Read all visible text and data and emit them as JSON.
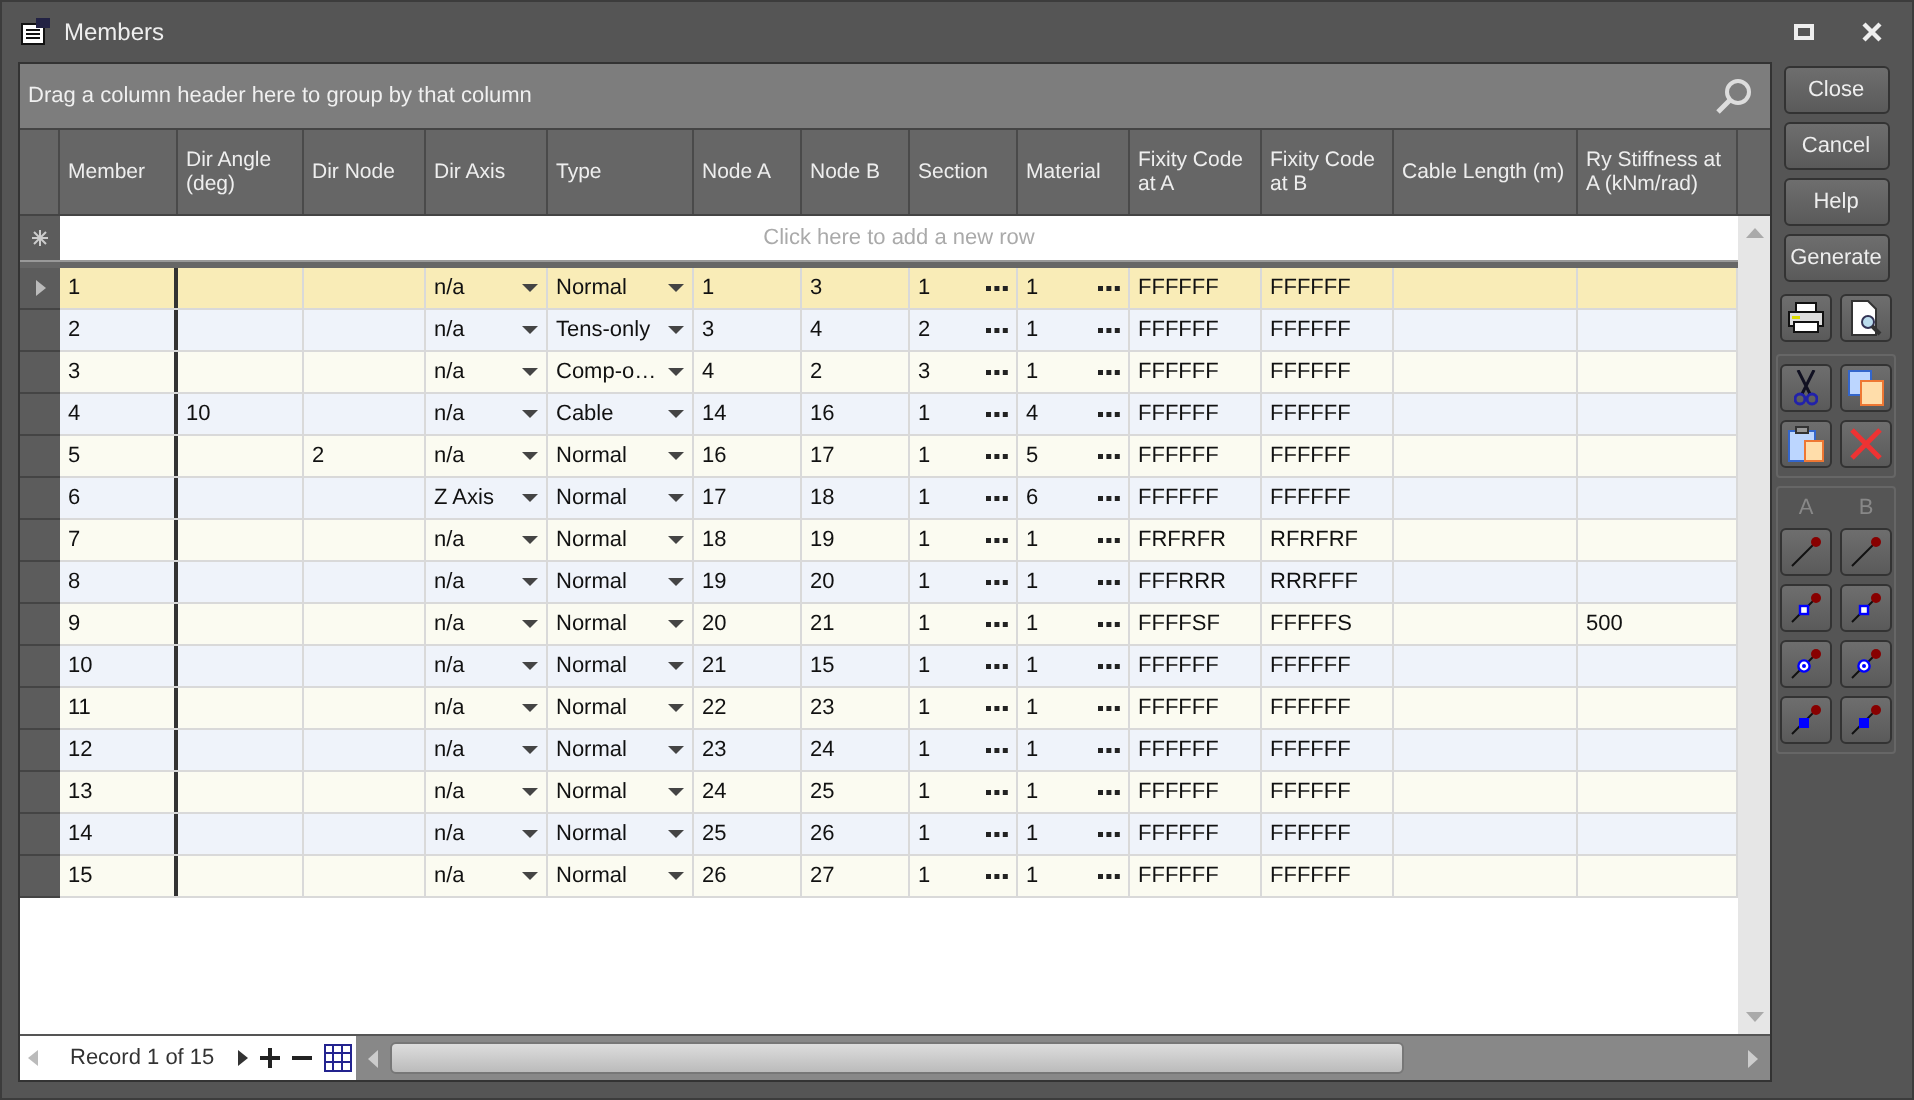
{
  "window": {
    "title": "Members"
  },
  "group_panel": {
    "hint": "Drag a column header here to group by that column"
  },
  "columns": [
    {
      "label": "Member",
      "kind": "text"
    },
    {
      "label": "Dir Angle (deg)",
      "kind": "text"
    },
    {
      "label": "Dir Node",
      "kind": "text"
    },
    {
      "label": "Dir Axis",
      "kind": "dropdown"
    },
    {
      "label": "Type",
      "kind": "dropdown"
    },
    {
      "label": "Node A",
      "kind": "text"
    },
    {
      "label": "Node B",
      "kind": "text"
    },
    {
      "label": "Section",
      "kind": "picker"
    },
    {
      "label": "Material",
      "kind": "picker"
    },
    {
      "label": "Fixity Code at A",
      "kind": "text"
    },
    {
      "label": "Fixity Code at B",
      "kind": "text"
    },
    {
      "label": "Cable Length (m)",
      "kind": "text"
    },
    {
      "label": "Ry Stiffness at A (kNm/rad)",
      "kind": "text"
    }
  ],
  "new_row": {
    "placeholder": "Click here to add a new row"
  },
  "rows": [
    {
      "selected": true,
      "member": "1",
      "dir_axis": "n/a",
      "type": "Normal",
      "node_a": "1",
      "node_b": "3",
      "section": "1",
      "material": "1",
      "fixity_a": "FFFFFF",
      "fixity_b": "FFFFFF"
    },
    {
      "selected": false,
      "member": "2",
      "dir_axis": "n/a",
      "type": "Tens-only",
      "node_a": "3",
      "node_b": "4",
      "section": "2",
      "material": "1",
      "fixity_a": "FFFFFF",
      "fixity_b": "FFFFFF"
    },
    {
      "selected": false,
      "member": "3",
      "dir_axis": "n/a",
      "type": "Comp-o…",
      "node_a": "4",
      "node_b": "2",
      "section": "3",
      "material": "1",
      "fixity_a": "FFFFFF",
      "fixity_b": "FFFFFF"
    },
    {
      "selected": false,
      "member": "4",
      "dir_angle": "10",
      "dir_axis": "n/a",
      "type": "Cable",
      "node_a": "14",
      "node_b": "16",
      "section": "1",
      "material": "4",
      "fixity_a": "FFFFFF",
      "fixity_b": "FFFFFF"
    },
    {
      "selected": false,
      "member": "5",
      "dir_node": "2",
      "dir_axis": "n/a",
      "type": "Normal",
      "node_a": "16",
      "node_b": "17",
      "section": "1",
      "material": "5",
      "fixity_a": "FFFFFF",
      "fixity_b": "FFFFFF"
    },
    {
      "selected": false,
      "member": "6",
      "dir_axis": "Z Axis",
      "type": "Normal",
      "node_a": "17",
      "node_b": "18",
      "section": "1",
      "material": "6",
      "fixity_a": "FFFFFF",
      "fixity_b": "FFFFFF"
    },
    {
      "selected": false,
      "member": "7",
      "dir_axis": "n/a",
      "type": "Normal",
      "node_a": "18",
      "node_b": "19",
      "section": "1",
      "material": "1",
      "fixity_a": "FRFRFR",
      "fixity_b": "RFRFRF"
    },
    {
      "selected": false,
      "member": "8",
      "dir_axis": "n/a",
      "type": "Normal",
      "node_a": "19",
      "node_b": "20",
      "section": "1",
      "material": "1",
      "fixity_a": "FFFRRR",
      "fixity_b": "RRRFFF"
    },
    {
      "selected": false,
      "member": "9",
      "dir_axis": "n/a",
      "type": "Normal",
      "node_a": "20",
      "node_b": "21",
      "section": "1",
      "material": "1",
      "fixity_a": "FFFFSF",
      "fixity_b": "FFFFFS",
      "ry_stiffness_a": "500"
    },
    {
      "selected": false,
      "member": "10",
      "dir_axis": "n/a",
      "type": "Normal",
      "node_a": "21",
      "node_b": "15",
      "section": "1",
      "material": "1",
      "fixity_a": "FFFFFF",
      "fixity_b": "FFFFFF"
    },
    {
      "selected": false,
      "member": "11",
      "dir_axis": "n/a",
      "type": "Normal",
      "node_a": "22",
      "node_b": "23",
      "section": "1",
      "material": "1",
      "fixity_a": "FFFFFF",
      "fixity_b": "FFFFFF"
    },
    {
      "selected": false,
      "member": "12",
      "dir_axis": "n/a",
      "type": "Normal",
      "node_a": "23",
      "node_b": "24",
      "section": "1",
      "material": "1",
      "fixity_a": "FFFFFF",
      "fixity_b": "FFFFFF"
    },
    {
      "selected": false,
      "member": "13",
      "dir_axis": "n/a",
      "type": "Normal",
      "node_a": "24",
      "node_b": "25",
      "section": "1",
      "material": "1",
      "fixity_a": "FFFFFF",
      "fixity_b": "FFFFFF"
    },
    {
      "selected": false,
      "member": "14",
      "dir_axis": "n/a",
      "type": "Normal",
      "node_a": "25",
      "node_b": "26",
      "section": "1",
      "material": "1",
      "fixity_a": "FFFFFF",
      "fixity_b": "FFFFFF"
    },
    {
      "selected": false,
      "member": "15",
      "dir_axis": "n/a",
      "type": "Normal",
      "node_a": "26",
      "node_b": "27",
      "section": "1",
      "material": "1",
      "fixity_a": "FFFFFF",
      "fixity_b": "FFFFFF"
    }
  ],
  "navigator": {
    "record_text": "Record 1 of 15"
  },
  "buttons": [
    "Close",
    "Cancel",
    "Help",
    "Generate"
  ],
  "tool_groups": [
    [
      {
        "kind": "print"
      },
      {
        "kind": "preview"
      }
    ],
    [
      {
        "kind": "cut"
      },
      {
        "kind": "copy"
      },
      {
        "kind": "paste"
      },
      {
        "kind": "delete"
      }
    ]
  ],
  "end_buttons": {
    "labels": [
      "A",
      "B"
    ],
    "rows": [
      {
        "kind": "plain"
      },
      {
        "kind": "open-square"
      },
      {
        "kind": "ring"
      },
      {
        "kind": "filled-square"
      }
    ]
  }
}
